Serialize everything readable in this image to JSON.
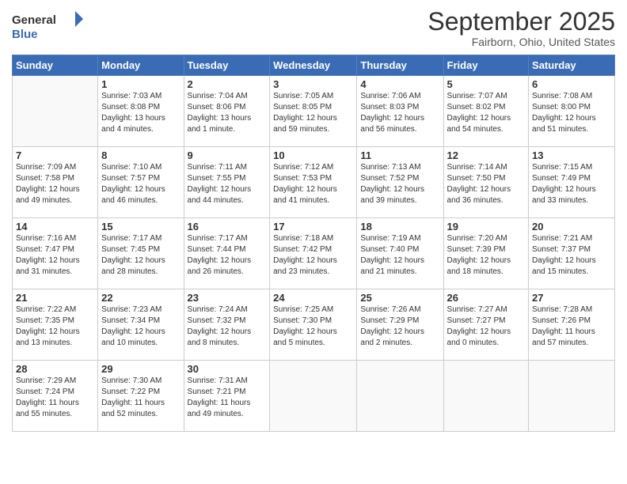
{
  "header": {
    "logo_line1": "General",
    "logo_line2": "Blue",
    "month_title": "September 2025",
    "location": "Fairborn, Ohio, United States"
  },
  "days_of_week": [
    "Sunday",
    "Monday",
    "Tuesday",
    "Wednesday",
    "Thursday",
    "Friday",
    "Saturday"
  ],
  "weeks": [
    [
      {
        "day": "",
        "info": ""
      },
      {
        "day": "1",
        "info": "Sunrise: 7:03 AM\nSunset: 8:08 PM\nDaylight: 13 hours\nand 4 minutes."
      },
      {
        "day": "2",
        "info": "Sunrise: 7:04 AM\nSunset: 8:06 PM\nDaylight: 13 hours\nand 1 minute."
      },
      {
        "day": "3",
        "info": "Sunrise: 7:05 AM\nSunset: 8:05 PM\nDaylight: 12 hours\nand 59 minutes."
      },
      {
        "day": "4",
        "info": "Sunrise: 7:06 AM\nSunset: 8:03 PM\nDaylight: 12 hours\nand 56 minutes."
      },
      {
        "day": "5",
        "info": "Sunrise: 7:07 AM\nSunset: 8:02 PM\nDaylight: 12 hours\nand 54 minutes."
      },
      {
        "day": "6",
        "info": "Sunrise: 7:08 AM\nSunset: 8:00 PM\nDaylight: 12 hours\nand 51 minutes."
      }
    ],
    [
      {
        "day": "7",
        "info": "Sunrise: 7:09 AM\nSunset: 7:58 PM\nDaylight: 12 hours\nand 49 minutes."
      },
      {
        "day": "8",
        "info": "Sunrise: 7:10 AM\nSunset: 7:57 PM\nDaylight: 12 hours\nand 46 minutes."
      },
      {
        "day": "9",
        "info": "Sunrise: 7:11 AM\nSunset: 7:55 PM\nDaylight: 12 hours\nand 44 minutes."
      },
      {
        "day": "10",
        "info": "Sunrise: 7:12 AM\nSunset: 7:53 PM\nDaylight: 12 hours\nand 41 minutes."
      },
      {
        "day": "11",
        "info": "Sunrise: 7:13 AM\nSunset: 7:52 PM\nDaylight: 12 hours\nand 39 minutes."
      },
      {
        "day": "12",
        "info": "Sunrise: 7:14 AM\nSunset: 7:50 PM\nDaylight: 12 hours\nand 36 minutes."
      },
      {
        "day": "13",
        "info": "Sunrise: 7:15 AM\nSunset: 7:49 PM\nDaylight: 12 hours\nand 33 minutes."
      }
    ],
    [
      {
        "day": "14",
        "info": "Sunrise: 7:16 AM\nSunset: 7:47 PM\nDaylight: 12 hours\nand 31 minutes."
      },
      {
        "day": "15",
        "info": "Sunrise: 7:17 AM\nSunset: 7:45 PM\nDaylight: 12 hours\nand 28 minutes."
      },
      {
        "day": "16",
        "info": "Sunrise: 7:17 AM\nSunset: 7:44 PM\nDaylight: 12 hours\nand 26 minutes."
      },
      {
        "day": "17",
        "info": "Sunrise: 7:18 AM\nSunset: 7:42 PM\nDaylight: 12 hours\nand 23 minutes."
      },
      {
        "day": "18",
        "info": "Sunrise: 7:19 AM\nSunset: 7:40 PM\nDaylight: 12 hours\nand 21 minutes."
      },
      {
        "day": "19",
        "info": "Sunrise: 7:20 AM\nSunset: 7:39 PM\nDaylight: 12 hours\nand 18 minutes."
      },
      {
        "day": "20",
        "info": "Sunrise: 7:21 AM\nSunset: 7:37 PM\nDaylight: 12 hours\nand 15 minutes."
      }
    ],
    [
      {
        "day": "21",
        "info": "Sunrise: 7:22 AM\nSunset: 7:35 PM\nDaylight: 12 hours\nand 13 minutes."
      },
      {
        "day": "22",
        "info": "Sunrise: 7:23 AM\nSunset: 7:34 PM\nDaylight: 12 hours\nand 10 minutes."
      },
      {
        "day": "23",
        "info": "Sunrise: 7:24 AM\nSunset: 7:32 PM\nDaylight: 12 hours\nand 8 minutes."
      },
      {
        "day": "24",
        "info": "Sunrise: 7:25 AM\nSunset: 7:30 PM\nDaylight: 12 hours\nand 5 minutes."
      },
      {
        "day": "25",
        "info": "Sunrise: 7:26 AM\nSunset: 7:29 PM\nDaylight: 12 hours\nand 2 minutes."
      },
      {
        "day": "26",
        "info": "Sunrise: 7:27 AM\nSunset: 7:27 PM\nDaylight: 12 hours\nand 0 minutes."
      },
      {
        "day": "27",
        "info": "Sunrise: 7:28 AM\nSunset: 7:26 PM\nDaylight: 11 hours\nand 57 minutes."
      }
    ],
    [
      {
        "day": "28",
        "info": "Sunrise: 7:29 AM\nSunset: 7:24 PM\nDaylight: 11 hours\nand 55 minutes."
      },
      {
        "day": "29",
        "info": "Sunrise: 7:30 AM\nSunset: 7:22 PM\nDaylight: 11 hours\nand 52 minutes."
      },
      {
        "day": "30",
        "info": "Sunrise: 7:31 AM\nSunset: 7:21 PM\nDaylight: 11 hours\nand 49 minutes."
      },
      {
        "day": "",
        "info": ""
      },
      {
        "day": "",
        "info": ""
      },
      {
        "day": "",
        "info": ""
      },
      {
        "day": "",
        "info": ""
      }
    ]
  ]
}
